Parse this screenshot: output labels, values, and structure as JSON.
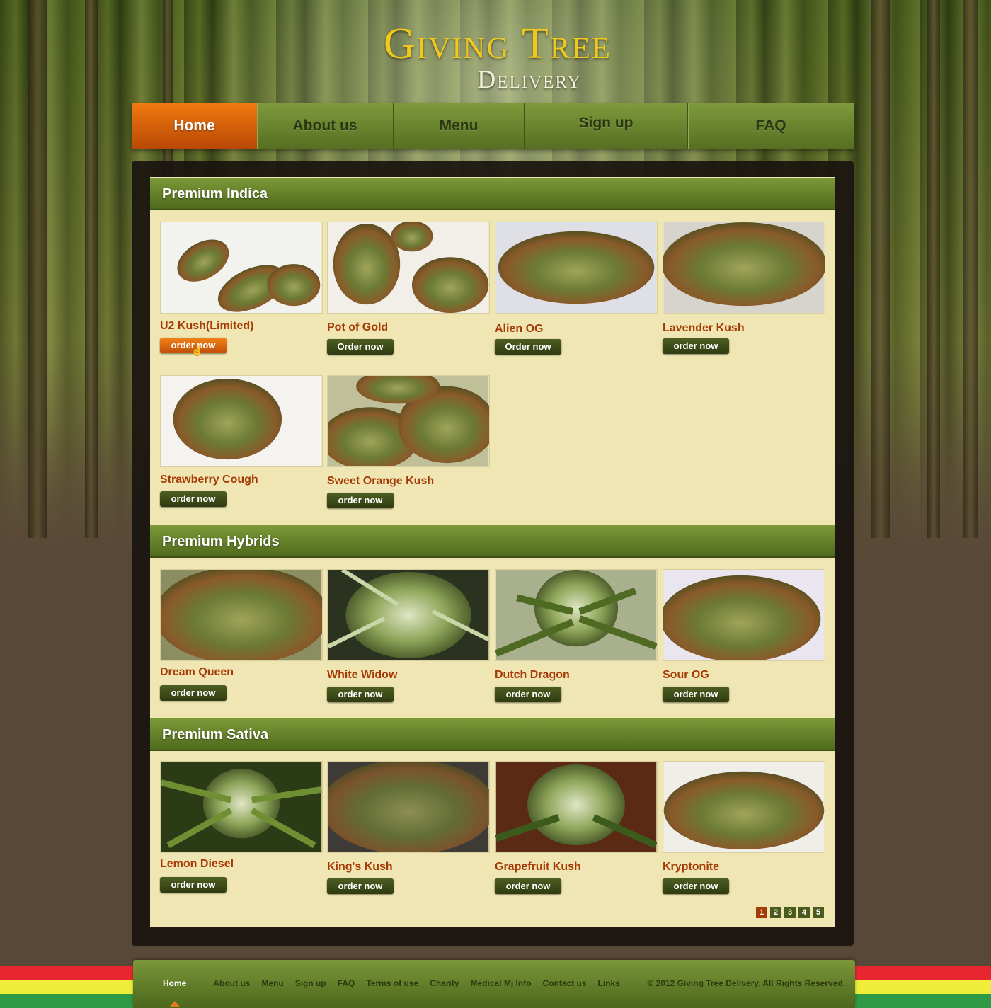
{
  "brand": {
    "name_main": "Giving Tree",
    "name_sub": "Delivery"
  },
  "nav": [
    {
      "label": "Home",
      "active": true
    },
    {
      "label": "About us"
    },
    {
      "label": "Menu"
    },
    {
      "label": "Sign up"
    },
    {
      "label": "FAQ"
    }
  ],
  "sections": [
    {
      "title": "Premium Indica",
      "products": [
        {
          "name": "U2 Kush(Limited)",
          "button": "order now",
          "hover": true
        },
        {
          "name": "Pot of Gold",
          "button": "Order now"
        },
        {
          "name": "Alien OG",
          "button": "Order now"
        },
        {
          "name": "Lavender Kush",
          "button": "order now"
        },
        {
          "name": "Strawberry Cough",
          "button": "order now"
        },
        {
          "name": "Sweet Orange Kush",
          "button": "order now"
        }
      ]
    },
    {
      "title": "Premium Hybrids",
      "products": [
        {
          "name": "Dream Queen",
          "button": "order now"
        },
        {
          "name": "White Widow",
          "button": "order now"
        },
        {
          "name": "Dutch Dragon",
          "button": "order now"
        },
        {
          "name": "Sour OG",
          "button": "order now"
        }
      ]
    },
    {
      "title": "Premium Sativa",
      "products": [
        {
          "name": "Lemon Diesel",
          "button": "order now"
        },
        {
          "name": "King's Kush",
          "button": "order now"
        },
        {
          "name": "Grapefruit Kush",
          "button": "order now"
        },
        {
          "name": "Kryptonite",
          "button": "order now"
        }
      ]
    }
  ],
  "pagination": {
    "pages": [
      "1",
      "2",
      "3",
      "4",
      "5"
    ],
    "current": "1"
  },
  "footer": {
    "links": [
      "Home",
      "About us",
      "Menu",
      "Sign up",
      "FAQ",
      "Terms of use",
      "Charity",
      "Medical Mj Info",
      "Contact us",
      "Links"
    ],
    "copyright": "© 2012 Giving  Tree Delivery. All Rights Reserved."
  },
  "colors": {
    "accent": "#e8700e",
    "nav_green": "#6b8a2e",
    "product_name": "#a63a06",
    "panel_bg": "#efe6b3"
  },
  "images": [
    "bud-thumbnail"
  ]
}
